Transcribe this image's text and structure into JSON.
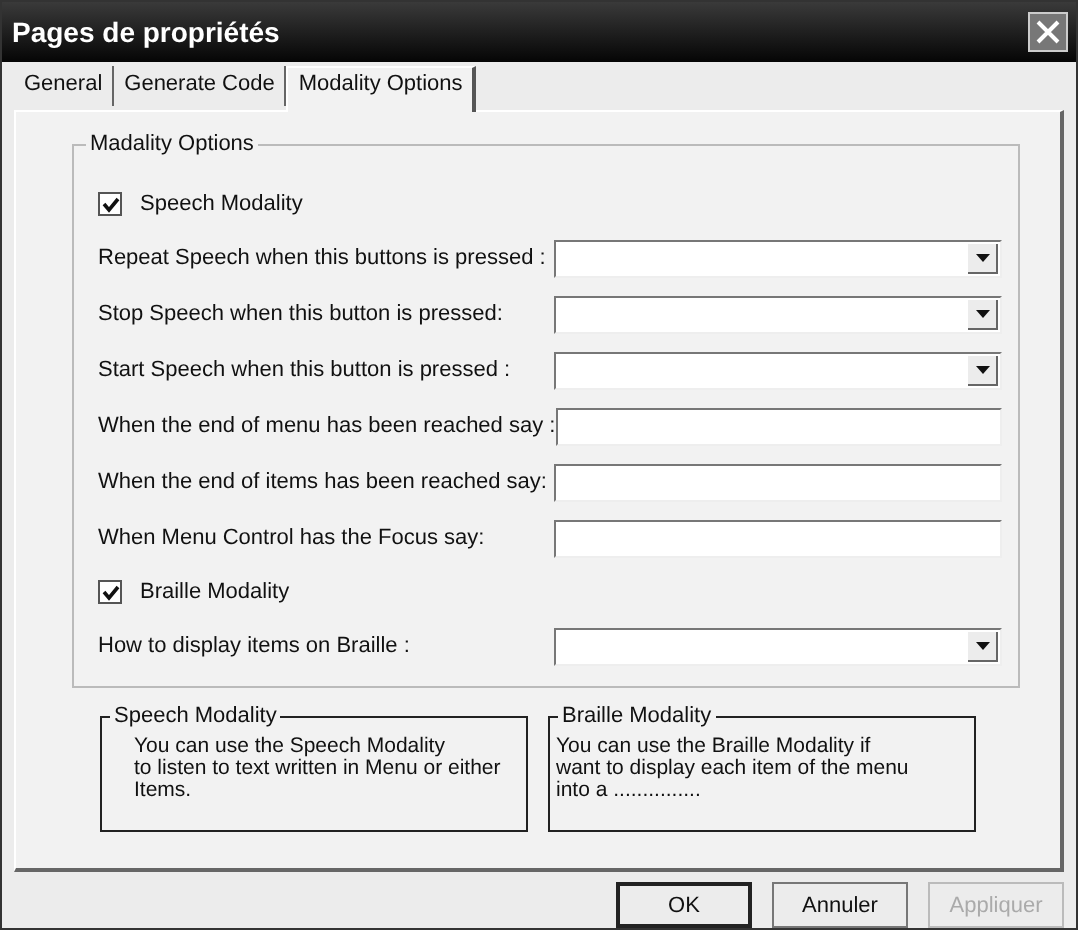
{
  "window": {
    "title": "Pages de propriétés"
  },
  "tabs": [
    {
      "label": "General",
      "selected": false
    },
    {
      "label": "Generate Code",
      "selected": false
    },
    {
      "label": "Modality Options",
      "selected": true
    }
  ],
  "group": {
    "title": "Madality Options",
    "rows": [
      {
        "kind": "checkbox",
        "label": "Speech Modality",
        "checked": true
      },
      {
        "kind": "combo",
        "label": "Repeat Speech when this buttons is pressed :"
      },
      {
        "kind": "combo",
        "label": "Stop Speech when this button is pressed:"
      },
      {
        "kind": "combo",
        "label": "Start Speech when this  button is pressed :"
      },
      {
        "kind": "text",
        "label": "When the end of menu has been reached say :"
      },
      {
        "kind": "text",
        "label": "When the end of items has been reached say:"
      },
      {
        "kind": "text",
        "label": "When Menu Control has the Focus say:"
      },
      {
        "kind": "checkbox",
        "label": "Braille Modality",
        "checked": true
      },
      {
        "kind": "combo",
        "label": "How to display items on Braille :"
      }
    ]
  },
  "info_boxes": [
    {
      "title": "Speech Modality",
      "text": "You can use the Speech Modality\nto listen to text written in Menu or either\nItems."
    },
    {
      "title": "Braille Modality",
      "text": "You can use the Braille Modality if\nwant to display each item of the menu\ninto a ..............."
    }
  ],
  "buttons": [
    {
      "label": "OK",
      "default": true,
      "disabled": false
    },
    {
      "label": "Annuler",
      "default": false,
      "disabled": false
    },
    {
      "label": "Appliquer",
      "default": false,
      "disabled": true
    }
  ]
}
